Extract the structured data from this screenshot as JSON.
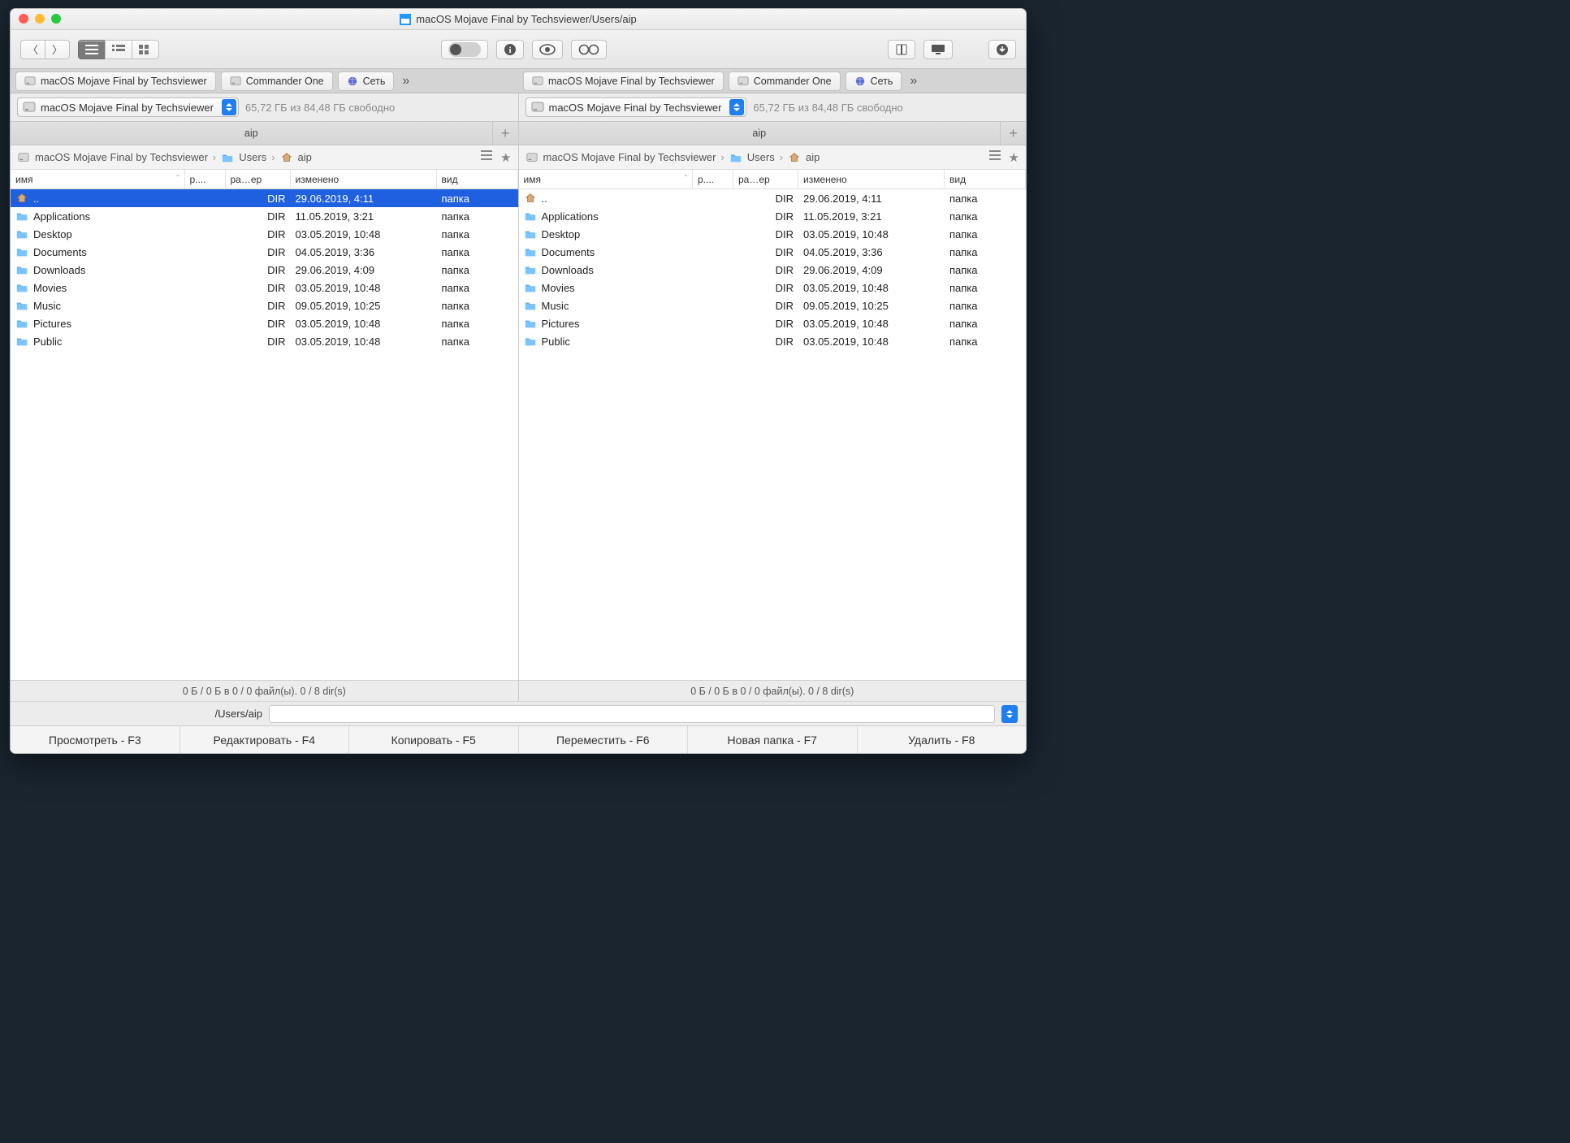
{
  "title": "macOS Mojave Final by Techsviewer/Users/aip",
  "drive_tabs": [
    {
      "icon": "hd",
      "label": "macOS Mojave Final by Techsviewer"
    },
    {
      "icon": "hd",
      "label": "Commander One"
    },
    {
      "icon": "globe",
      "label": "Сеть"
    }
  ],
  "volume": {
    "label": "macOS Mojave Final by Techsviewer",
    "free": "65,72 ГБ из 84,48 ГБ свободно"
  },
  "folder_tab": "aip",
  "breadcrumbs": [
    {
      "icon": "hd",
      "label": "macOS Mojave Final by Techsviewer"
    },
    {
      "icon": "folder",
      "label": "Users"
    },
    {
      "icon": "home",
      "label": "aip"
    }
  ],
  "columns": {
    "name": "имя",
    "ext": "р....",
    "size": "ра…ер",
    "modified": "изменено",
    "kind": "вид",
    "w_ext": 50,
    "w_size": 80,
    "w_mod": 180,
    "w_kind": 100
  },
  "rows": [
    {
      "icon": "home",
      "name": "..",
      "size": "DIR",
      "modified": "29.06.2019, 4:11",
      "kind": "папка",
      "selected": true
    },
    {
      "icon": "folder",
      "name": "Applications",
      "size": "DIR",
      "modified": "11.05.2019, 3:21",
      "kind": "папка"
    },
    {
      "icon": "folder",
      "name": "Desktop",
      "size": "DIR",
      "modified": "03.05.2019, 10:48",
      "kind": "папка"
    },
    {
      "icon": "folder",
      "name": "Documents",
      "size": "DIR",
      "modified": "04.05.2019, 3:36",
      "kind": "папка"
    },
    {
      "icon": "folder",
      "name": "Downloads",
      "size": "DIR",
      "modified": "29.06.2019, 4:09",
      "kind": "папка"
    },
    {
      "icon": "folder",
      "name": "Movies",
      "size": "DIR",
      "modified": "03.05.2019, 10:48",
      "kind": "папка"
    },
    {
      "icon": "folder",
      "name": "Music",
      "size": "DIR",
      "modified": "09.05.2019, 10:25",
      "kind": "папка"
    },
    {
      "icon": "folder",
      "name": "Pictures",
      "size": "DIR",
      "modified": "03.05.2019, 10:48",
      "kind": "папка"
    },
    {
      "icon": "folder",
      "name": "Public",
      "size": "DIR",
      "modified": "03.05.2019, 10:48",
      "kind": "папка"
    }
  ],
  "status": "0 Б / 0 Б в 0 / 0 файл(ы). 0 / 8 dir(s)",
  "path_label": "/Users/aip",
  "fkeys": [
    "Просмотреть - F3",
    "Редактировать - F4",
    "Копировать - F5",
    "Переместить - F6",
    "Новая папка - F7",
    "Удалить - F8"
  ]
}
